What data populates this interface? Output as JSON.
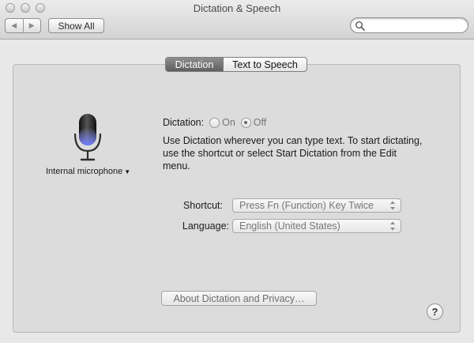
{
  "window": {
    "title": "Dictation & Speech"
  },
  "toolbar": {
    "back_glyph": "◀",
    "forward_glyph": "▶",
    "show_all_label": "Show All",
    "search": {
      "value": "",
      "placeholder": ""
    }
  },
  "tabs": [
    {
      "label": "Dictation",
      "active": true
    },
    {
      "label": "Text to Speech",
      "active": false
    }
  ],
  "microphone": {
    "icon": "microphone-icon",
    "source_label": "Internal microphone",
    "menu_arrow": "▼"
  },
  "dictation": {
    "label": "Dictation:",
    "options": [
      {
        "label": "On",
        "checked": false
      },
      {
        "label": "Off",
        "checked": true
      }
    ],
    "description": "Use Dictation wherever you can type text. To start dictating, use the shortcut or select Start Dictation from the Edit menu."
  },
  "fields": {
    "shortcut": {
      "label": "Shortcut:",
      "value": "Press Fn (Function) Key Twice"
    },
    "language": {
      "label": "Language:",
      "value": "English (United States)"
    }
  },
  "about_button_label": "About Dictation and Privacy…",
  "help_label": "?",
  "colors": {
    "mic_accent": "#6f7dff",
    "active_tab": "#707070"
  }
}
